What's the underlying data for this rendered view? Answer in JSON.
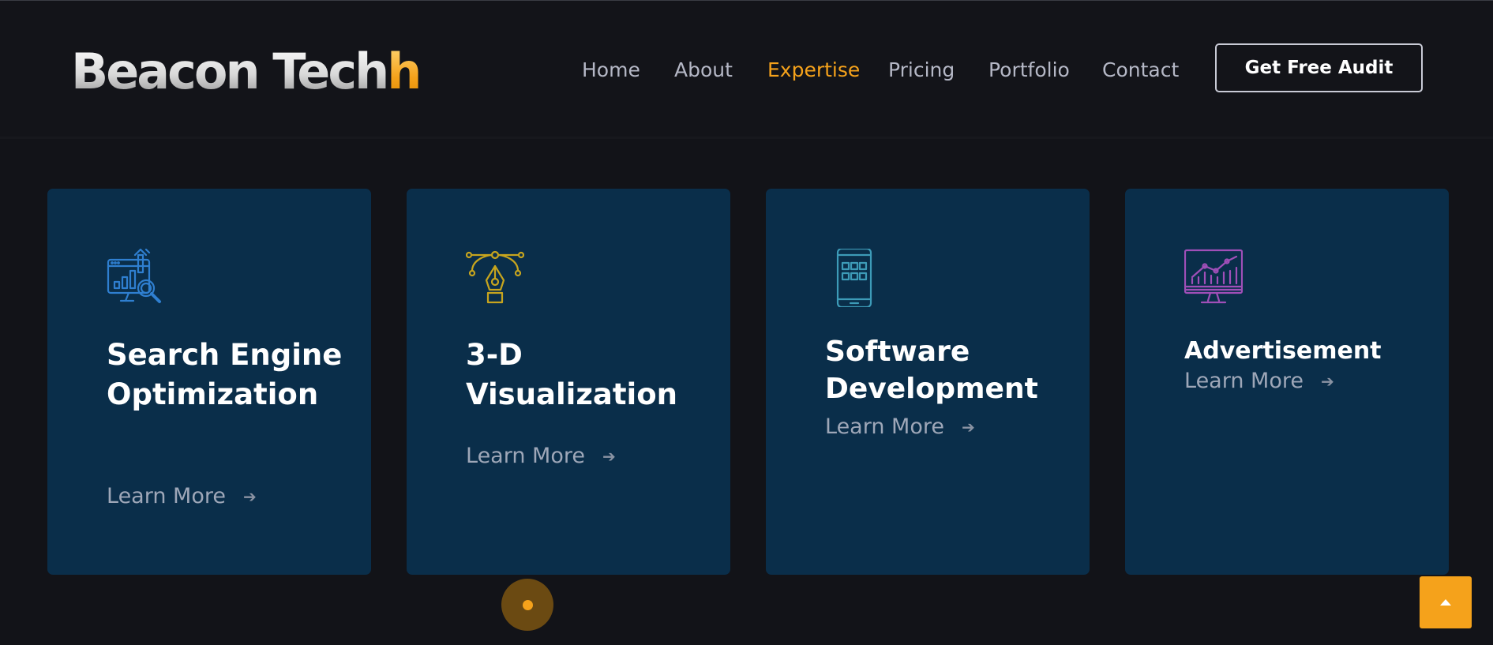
{
  "brand": {
    "logo_main": "Beacon Tech",
    "logo_accent": "h"
  },
  "nav": {
    "items": [
      {
        "label": "Home",
        "active": false
      },
      {
        "label": "About",
        "active": false
      },
      {
        "label": "Expertise",
        "active": true
      },
      {
        "label": "Pricing",
        "active": false
      },
      {
        "label": "Portfolio",
        "active": false
      },
      {
        "label": "Contact",
        "active": false
      }
    ],
    "cta_label": "Get Free Audit"
  },
  "cards": [
    {
      "title": "Search Engine Optimization",
      "link": "Learn More",
      "icon": "seo-analytics-icon",
      "icon_color": "#2f7fd0"
    },
    {
      "title": "3-D Visualization",
      "link": "Learn More",
      "icon": "pen-tool-icon",
      "icon_color": "#c7a51e"
    },
    {
      "title": "Software Development",
      "link": "Learn More",
      "icon": "mobile-app-icon",
      "icon_color": "#3d9bb8"
    },
    {
      "title": "Advertisement",
      "link": "Learn More",
      "icon": "monitor-chart-icon",
      "icon_color": "#a04fb8"
    }
  ],
  "colors": {
    "accent": "#f5a21b",
    "card_bg": "#0a2e4a",
    "page_bg": "#121318"
  }
}
